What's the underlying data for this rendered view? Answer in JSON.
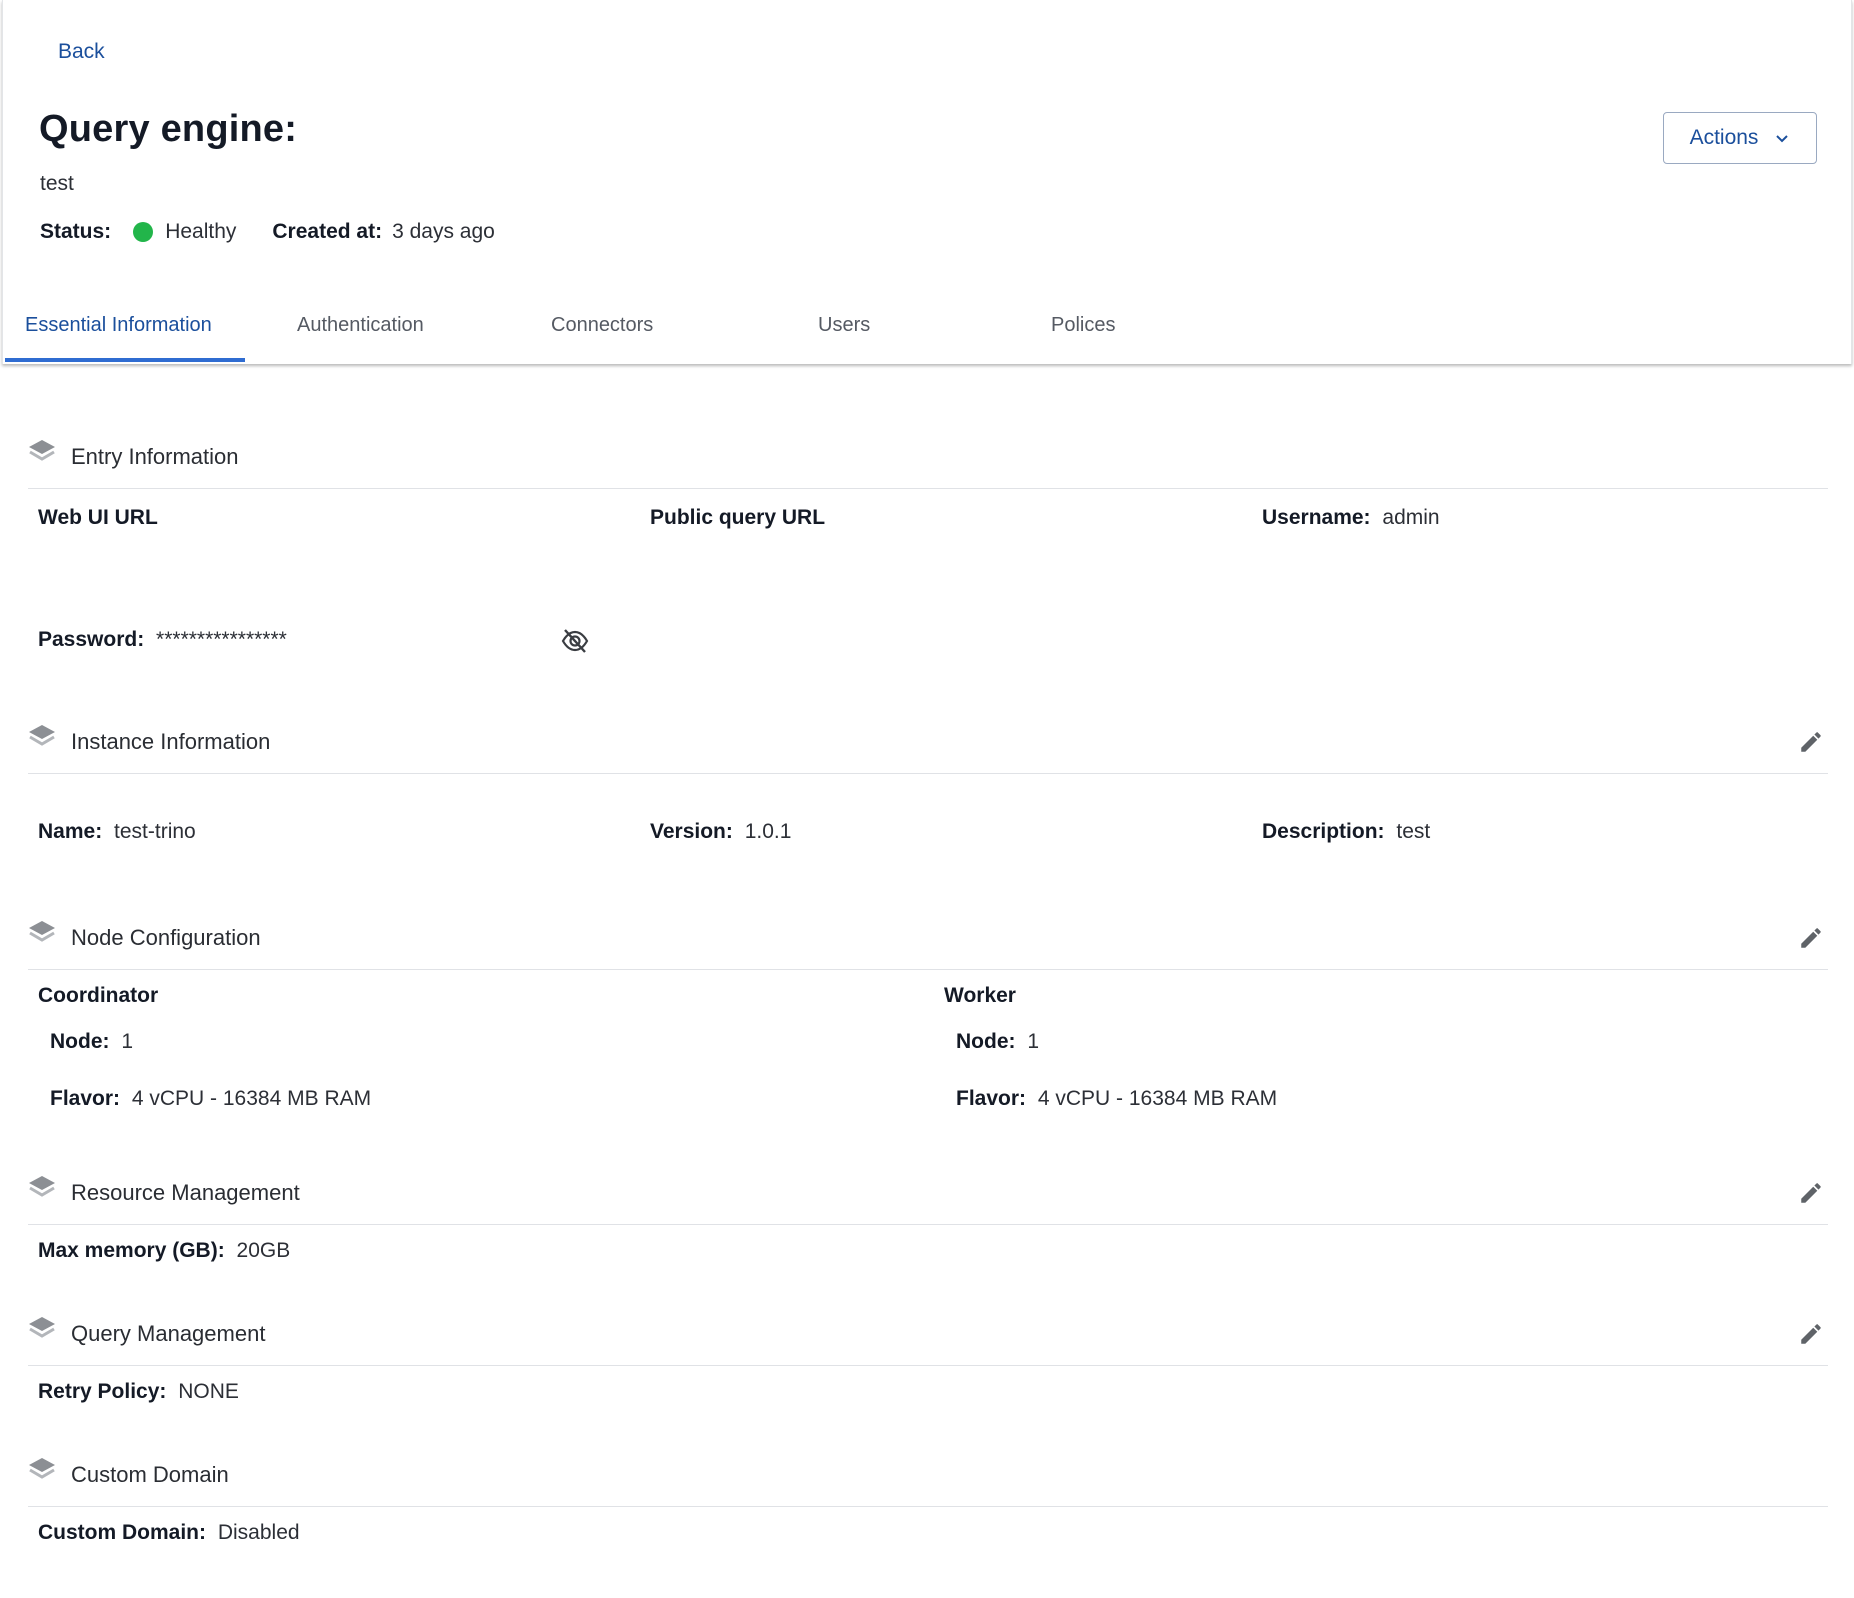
{
  "header": {
    "back_label": "Back",
    "title": "Query engine:",
    "subtitle": "test",
    "status_label": "Status:",
    "status_value": "Healthy",
    "status_color": "#22b54a",
    "created_label": "Created at:",
    "created_value": "3 days ago",
    "actions_label": "Actions"
  },
  "tabs": [
    {
      "label": "Essential Information",
      "active": true
    },
    {
      "label": "Authentication",
      "active": false
    },
    {
      "label": "Connectors",
      "active": false
    },
    {
      "label": "Users",
      "active": false
    },
    {
      "label": "Polices",
      "active": false
    }
  ],
  "sections": {
    "entry": {
      "title": "Entry Information",
      "web_ui_url_label": "Web UI URL",
      "public_query_url_label": "Public query URL",
      "username_label": "Username:",
      "username_value": "admin",
      "password_label": "Password:",
      "password_value": "****************"
    },
    "instance": {
      "title": "Instance Information",
      "name_label": "Name:",
      "name_value": "test-trino",
      "version_label": "Version:",
      "version_value": "1.0.1",
      "description_label": "Description:",
      "description_value": "test"
    },
    "node": {
      "title": "Node Configuration",
      "coordinator_label": "Coordinator",
      "coordinator_node_label": "Node:",
      "coordinator_node_value": "1",
      "coordinator_flavor_label": "Flavor:",
      "coordinator_flavor_value": "4 vCPU - 16384 MB RAM",
      "worker_label": "Worker",
      "worker_node_label": "Node:",
      "worker_node_value": "1",
      "worker_flavor_label": "Flavor:",
      "worker_flavor_value": "4 vCPU - 16384 MB RAM"
    },
    "resource": {
      "title": "Resource Management",
      "max_memory_label": "Max memory (GB):",
      "max_memory_value": "20GB"
    },
    "query": {
      "title": "Query Management",
      "retry_policy_label": "Retry Policy:",
      "retry_policy_value": "NONE"
    },
    "domain": {
      "title": "Custom Domain",
      "custom_domain_label": "Custom Domain:",
      "custom_domain_value": "Disabled"
    }
  },
  "colors": {
    "accent": "#1b4f9c",
    "tab_underline": "#2f6cd1",
    "healthy": "#22b54a"
  },
  "icons": [
    "layers-icon",
    "edit-icon",
    "eye-off-icon",
    "chevron-down-icon"
  ]
}
